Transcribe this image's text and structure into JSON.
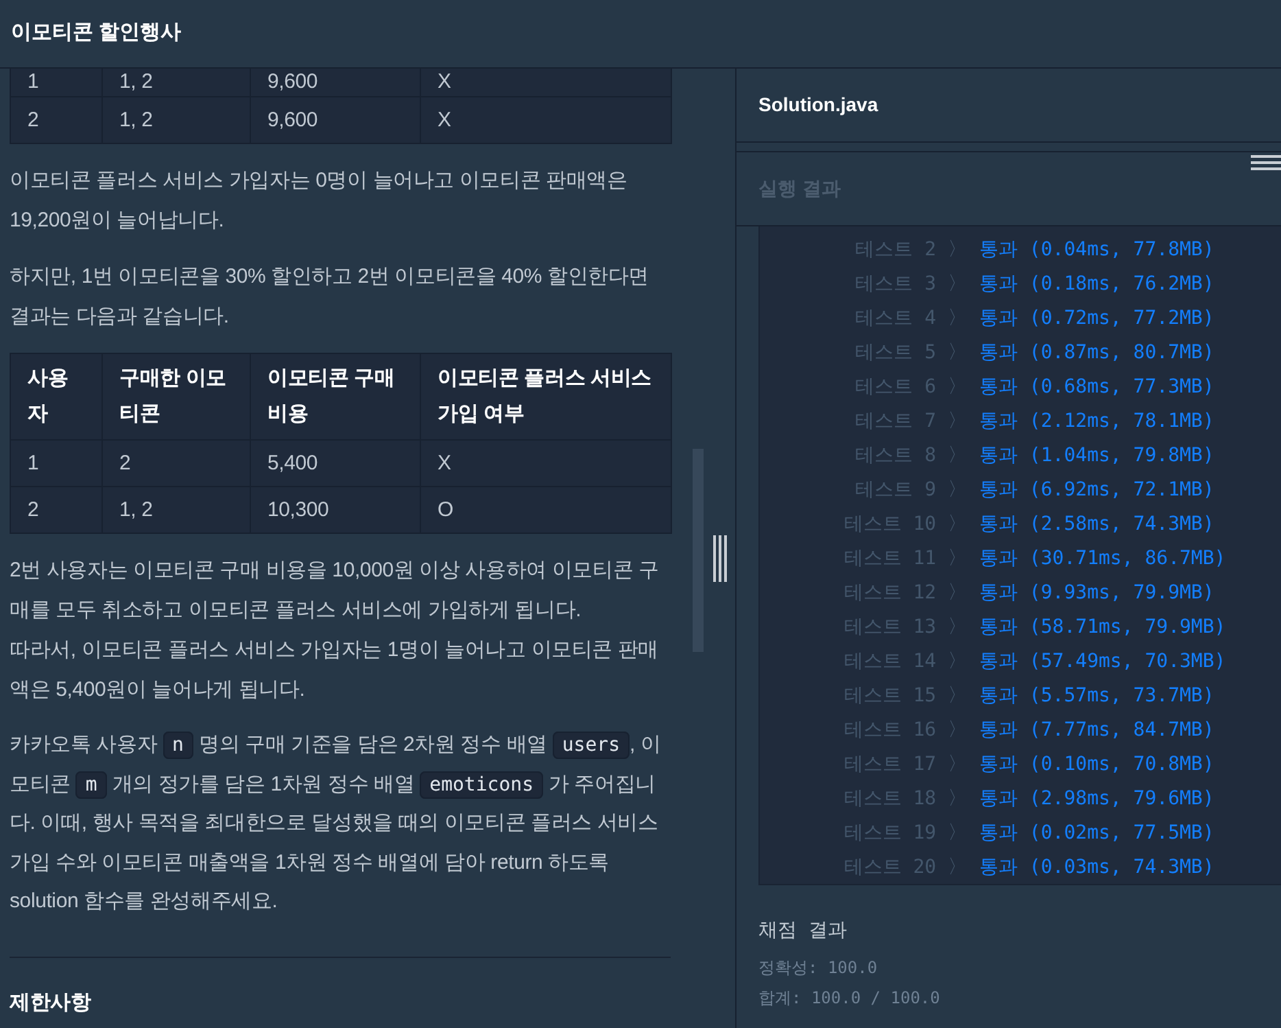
{
  "header": {
    "title": "이모티콘 할인행사"
  },
  "problem": {
    "blocks": [
      {
        "kind": "table",
        "rows": [
          [
            "1",
            "1, 2",
            "9,600",
            "X"
          ],
          [
            "2",
            "1, 2",
            "9,600",
            "X"
          ]
        ]
      },
      {
        "kind": "paragraph",
        "lines": [
          "이모티콘 플러스 서비스 가입자는 0명이 늘어나고 이모티콘 판매액은 19,200원이 늘어납니다."
        ]
      },
      {
        "kind": "paragraph",
        "lines": [
          "하지만, 1번 이모티콘을 30% 할인하고 2번 이모티콘을 40% 할인한다면 결과는 다음과 같습니다."
        ]
      },
      {
        "kind": "table",
        "columns": [
          "사용자",
          "구매한 이모티콘",
          "이모티콘 구매 비용",
          "이모티콘 플러스 서비스 가입 여부"
        ],
        "rows": [
          [
            "1",
            "2",
            "5,400",
            "X"
          ],
          [
            "2",
            "1, 2",
            "10,300",
            "O"
          ]
        ]
      },
      {
        "kind": "paragraph",
        "lines": [
          "2번 사용자는 이모티콘 구매 비용을 10,000원 이상 사용하여 이모티콘 구매를 모두 취소하고 이모티콘 플러스 서비스에 가입하게 됩니다.",
          "따라서, 이모티콘 플러스 서비스 가입자는 1명이 늘어나고 이모티콘 판매액은 5,400원이 늘어나게 됩니다."
        ]
      },
      {
        "kind": "rich_paragraph",
        "segments": [
          {
            "kind": "text",
            "text": "카카오톡 사용자 "
          },
          {
            "kind": "code",
            "text": "n"
          },
          {
            "kind": "text",
            "text": " 명의 구매 기준을 담은 2차원 정수 배열 "
          },
          {
            "kind": "code",
            "text": "users"
          },
          {
            "kind": "text",
            "text": ", 이모티콘 "
          },
          {
            "kind": "code",
            "text": "m"
          },
          {
            "kind": "text",
            "text": " 개의 정가를 담은 1차원 정수 배열 "
          },
          {
            "kind": "code",
            "text": "emoticons"
          },
          {
            "kind": "text",
            "text": " 가 주어집니다. 이때, 행사 목적을 최대한으로 달성했을 때의 이모티콘 플러스 서비스 가입 수와 이모티콘 매출액을 1차원 정수 배열에 담아 return 하도록 solution 함수를 완성해주세요."
          }
        ]
      },
      {
        "kind": "divider"
      },
      {
        "kind": "heading",
        "text": "제한사항"
      }
    ]
  },
  "editor": {
    "file_name": "Solution.java"
  },
  "results": {
    "title": "실행 결과",
    "tests": [
      {
        "label": "테스트 2 〉",
        "result": "통과 (0.04ms, 77.8MB)"
      },
      {
        "label": "테스트 3 〉",
        "result": "통과 (0.18ms, 76.2MB)"
      },
      {
        "label": "테스트 4 〉",
        "result": "통과 (0.72ms, 77.2MB)"
      },
      {
        "label": "테스트 5 〉",
        "result": "통과 (0.87ms, 80.7MB)"
      },
      {
        "label": "테스트 6 〉",
        "result": "통과 (0.68ms, 77.3MB)"
      },
      {
        "label": "테스트 7 〉",
        "result": "통과 (2.12ms, 78.1MB)"
      },
      {
        "label": "테스트 8 〉",
        "result": "통과 (1.04ms, 79.8MB)"
      },
      {
        "label": "테스트 9 〉",
        "result": "통과 (6.92ms, 72.1MB)"
      },
      {
        "label": "테스트 10 〉",
        "result": "통과 (2.58ms, 74.3MB)"
      },
      {
        "label": "테스트 11 〉",
        "result": "통과 (30.71ms, 86.7MB)"
      },
      {
        "label": "테스트 12 〉",
        "result": "통과 (9.93ms, 79.9MB)"
      },
      {
        "label": "테스트 13 〉",
        "result": "통과 (58.71ms, 79.9MB)"
      },
      {
        "label": "테스트 14 〉",
        "result": "통과 (57.49ms, 70.3MB)"
      },
      {
        "label": "테스트 15 〉",
        "result": "통과 (5.57ms, 73.7MB)"
      },
      {
        "label": "테스트 16 〉",
        "result": "통과 (7.77ms, 84.7MB)"
      },
      {
        "label": "테스트 17 〉",
        "result": "통과 (0.10ms, 70.8MB)"
      },
      {
        "label": "테스트 18 〉",
        "result": "통과 (2.98ms, 79.6MB)"
      },
      {
        "label": "테스트 19 〉",
        "result": "통과 (0.02ms, 77.5MB)"
      },
      {
        "label": "테스트 20 〉",
        "result": "통과 (0.03ms, 74.3MB)"
      }
    ]
  },
  "grading": {
    "title": "채점 결과",
    "lines": [
      "정확성: 100.0",
      "합계: 100.0 / 100.0"
    ]
  }
}
